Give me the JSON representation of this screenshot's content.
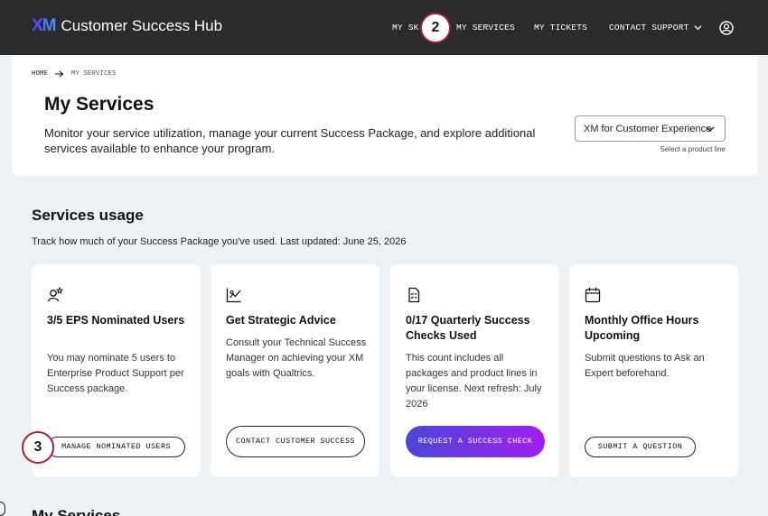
{
  "app": {
    "logo_mark": "XM",
    "title": "Customer Success Hub"
  },
  "nav": {
    "skills": "MY SK",
    "services": "MY SERVICES",
    "tickets": "MY TICKETS",
    "support": "CONTACT SUPPORT",
    "user_icon": "user-circle-icon"
  },
  "badges": {
    "step_a": "2",
    "step_b": "3"
  },
  "breadcrumb": {
    "home": "HOME",
    "current": "MY SERVICES"
  },
  "header": {
    "title": "My Services",
    "description": "Monitor your service utilization, manage your current Success Package, and explore additional services available to enhance your program.",
    "product_select_value": "XM for Customer Experience",
    "product_select_hint": "Select a product line"
  },
  "usage": {
    "title": "Services usage",
    "description": "Track how much of your Success Package you've used. Last updated: June 25, 2026",
    "cards": [
      {
        "icon": "user-star-icon",
        "title": "3/5 EPS Nominated Users",
        "body": "You may nominate 5 users to Enterprise Product Support per Success package.",
        "button": "MANAGE NOMINATED USERS"
      },
      {
        "icon": "chart-trend-icon",
        "title": "Get Strategic Advice",
        "body": "Consult your Technical Success Manager on achieving your XM goals with Qualtrics.",
        "button": "CONTACT CUSTOMER SUCCESS"
      },
      {
        "icon": "checklist-icon",
        "title": "0/17 Quarterly Success Checks Used",
        "body": "This count includes all packages and product lines in your license. Next refresh: July 2026",
        "button": "REQUEST A SUCCESS CHECK"
      },
      {
        "icon": "calendar-icon",
        "title": "Monthly Office Hours Upcoming",
        "body": "Submit questions to Ask an Expert beforehand.",
        "button": "SUBMIT A QUESTION"
      }
    ]
  },
  "next_section_title": "My Services",
  "colors": {
    "topbar": "#2b2b2b",
    "background": "#eef1f4",
    "badge_border": "#a5233a",
    "gradient_start": "#4a47d6",
    "gradient_end": "#a21ef0"
  }
}
